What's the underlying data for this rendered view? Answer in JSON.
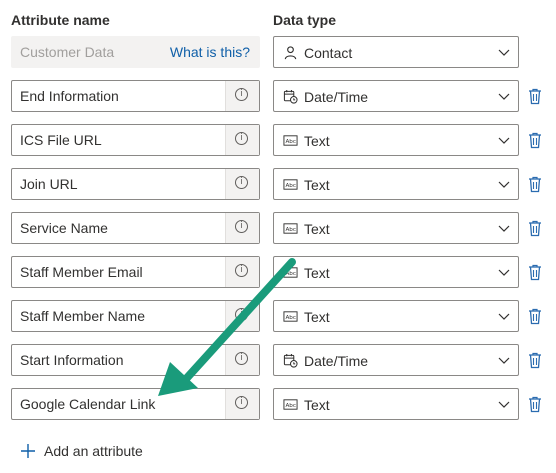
{
  "headers": {
    "attribute_name": "Attribute name",
    "data_type": "Data type"
  },
  "customer_row": {
    "placeholder": "Customer Data",
    "link": "What is this?",
    "type": "Contact",
    "type_icon": "person-icon"
  },
  "attributes": [
    {
      "name": "End Information",
      "type": "Date/Time",
      "type_icon": "calendar-clock-icon"
    },
    {
      "name": "ICS File URL",
      "type": "Text",
      "type_icon": "text-field-icon"
    },
    {
      "name": "Join URL",
      "type": "Text",
      "type_icon": "text-field-icon"
    },
    {
      "name": "Service Name",
      "type": "Text",
      "type_icon": "text-field-icon"
    },
    {
      "name": "Staff Member Email",
      "type": "Text",
      "type_icon": "text-field-icon"
    },
    {
      "name": "Staff Member Name",
      "type": "Text",
      "type_icon": "text-field-icon"
    },
    {
      "name": "Start Information",
      "type": "Date/Time",
      "type_icon": "calendar-clock-icon"
    },
    {
      "name": "Google Calendar Link",
      "type": "Text",
      "type_icon": "text-field-icon"
    }
  ],
  "add_button": {
    "label": "Add an attribute"
  },
  "colors": {
    "accent": "#0f5fa8",
    "arrow": "#1a9b7b",
    "trash": "#2b6cb0"
  },
  "info_glyph": "i"
}
